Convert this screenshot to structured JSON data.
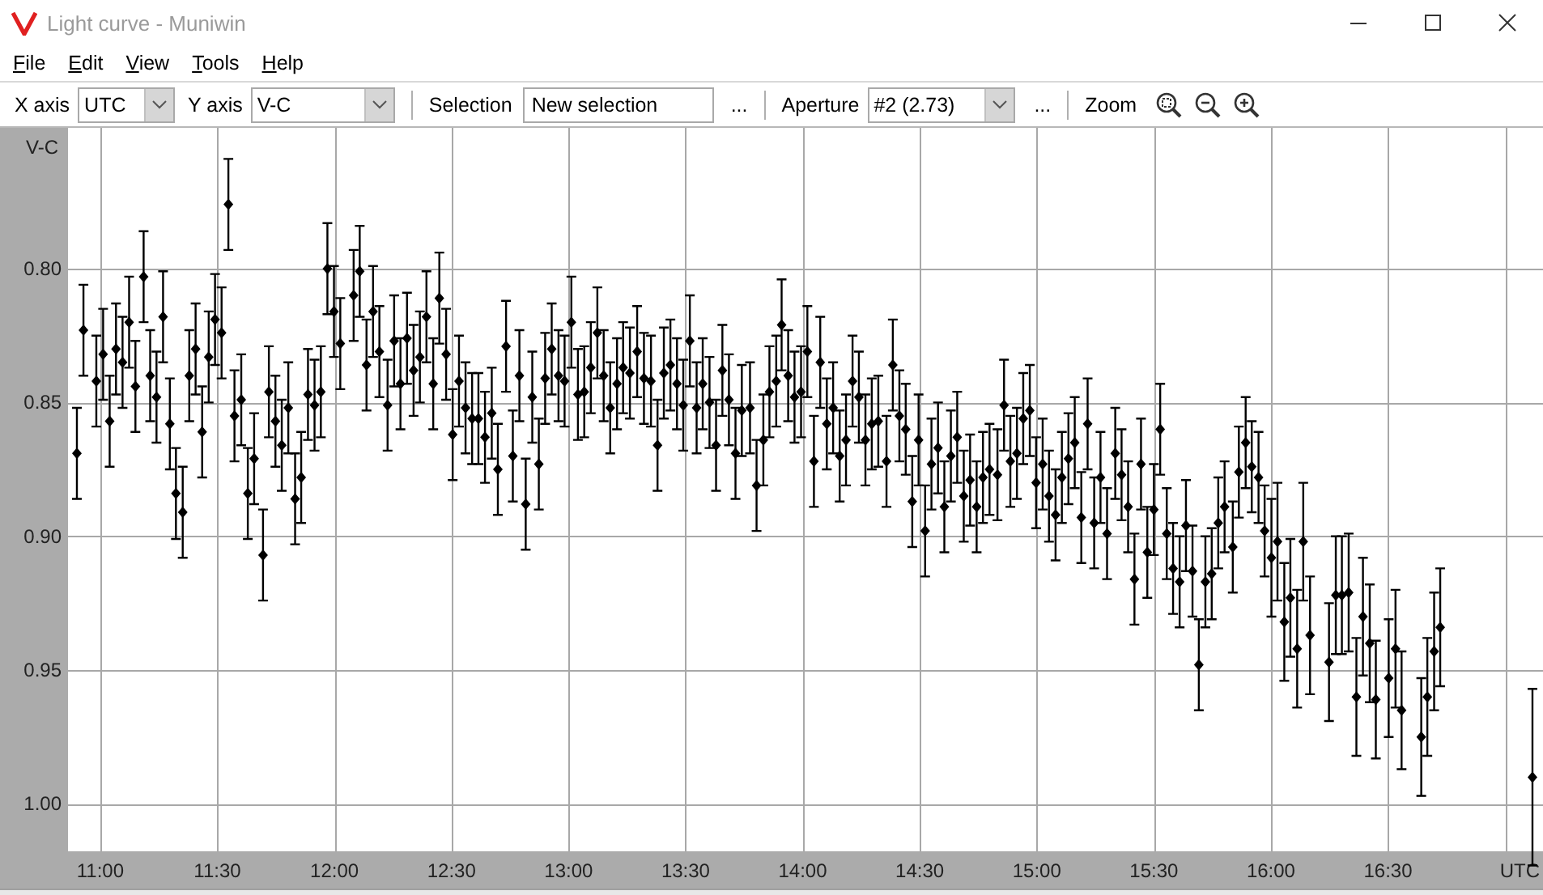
{
  "window": {
    "title": "Light curve - Muniwin"
  },
  "menu": [
    "File",
    "Edit",
    "View",
    "Tools",
    "Help"
  ],
  "toolbar": {
    "x_axis": {
      "label": "X axis",
      "value": "UTC"
    },
    "y_axis": {
      "label": "Y axis",
      "value": "V-C"
    },
    "selection": {
      "label": "Selection",
      "value": "New selection",
      "button": "..."
    },
    "aperture": {
      "label": "Aperture",
      "value": "#2 (2.73)",
      "button": "..."
    },
    "zoom": {
      "label": "Zoom"
    }
  },
  "plot": {
    "chart_data": {
      "type": "scatter",
      "xlabel": "UTC",
      "ylabel": "V-C",
      "grid": true,
      "xlim": [
        10.862,
        17.162
      ],
      "ylim": [
        1.0177,
        0.7486
      ],
      "xticks": [
        {
          "value": 11,
          "label": "11:00"
        },
        {
          "value": 11.5,
          "label": "11:30"
        },
        {
          "value": 12,
          "label": "12:00"
        },
        {
          "value": 12.5,
          "label": "12:30"
        },
        {
          "value": 13,
          "label": "13:00"
        },
        {
          "value": 13.5,
          "label": "13:30"
        },
        {
          "value": 14,
          "label": "14:00"
        },
        {
          "value": 14.5,
          "label": "14:30"
        },
        {
          "value": 15,
          "label": "15:00"
        },
        {
          "value": 15.5,
          "label": "15:30"
        },
        {
          "value": 16,
          "label": "16:00"
        },
        {
          "value": 16.5,
          "label": "16:30"
        }
      ],
      "yticks": [
        {
          "value": 0.8,
          "label": "0.80"
        },
        {
          "value": 0.85,
          "label": "0.85"
        },
        {
          "value": 0.9,
          "label": "0.90"
        },
        {
          "value": 0.95,
          "label": "0.95"
        },
        {
          "value": 1.0,
          "label": "1.00"
        }
      ],
      "x": [
        10.9,
        10.928,
        10.983,
        11.012,
        11.04,
        11.067,
        11.095,
        11.123,
        11.15,
        11.185,
        11.213,
        11.24,
        11.268,
        11.297,
        11.323,
        11.352,
        11.38,
        11.407,
        11.435,
        11.463,
        11.49,
        11.518,
        11.547,
        11.573,
        11.602,
        11.63,
        11.657,
        11.695,
        11.72,
        11.748,
        11.775,
        11.803,
        11.832,
        11.858,
        11.887,
        11.915,
        11.942,
        11.97,
        11.998,
        12.025,
        12.082,
        12.108,
        12.137,
        12.165,
        12.192,
        12.227,
        12.255,
        12.282,
        12.31,
        12.338,
        12.365,
        12.393,
        12.422,
        12.448,
        12.477,
        12.505,
        12.532,
        12.56,
        12.588,
        12.615,
        12.643,
        12.672,
        12.698,
        12.733,
        12.762,
        12.79,
        12.817,
        12.845,
        12.873,
        12.9,
        12.928,
        12.957,
        12.983,
        13.012,
        13.04,
        13.067,
        13.095,
        13.123,
        13.15,
        13.178,
        13.207,
        13.233,
        13.262,
        13.293,
        13.322,
        13.352,
        13.38,
        13.407,
        13.435,
        13.463,
        13.49,
        13.518,
        13.547,
        13.573,
        13.602,
        13.63,
        13.657,
        13.685,
        13.713,
        13.74,
        13.775,
        13.803,
        13.832,
        13.858,
        13.887,
        13.91,
        13.938,
        13.965,
        13.993,
        14.02,
        14.048,
        14.075,
        14.103,
        14.13,
        14.158,
        14.185,
        14.213,
        14.24,
        14.268,
        14.295,
        14.323,
        14.358,
        14.385,
        14.413,
        14.44,
        14.468,
        14.495,
        14.523,
        14.55,
        14.578,
        14.605,
        14.633,
        14.66,
        14.688,
        14.715,
        14.743,
        14.77,
        14.798,
        14.832,
        14.86,
        14.887,
        14.915,
        14.942,
        14.97,
        14.997,
        15.025,
        15.052,
        15.08,
        15.107,
        15.135,
        15.162,
        15.19,
        15.217,
        15.245,
        15.272,
        15.3,
        15.335,
        15.362,
        15.39,
        15.417,
        15.445,
        15.472,
        15.5,
        15.527,
        15.555,
        15.582,
        15.61,
        15.637,
        15.665,
        15.692,
        15.72,
        15.747,
        15.775,
        15.802,
        15.837,
        15.863,
        15.892,
        15.918,
        15.947,
        15.973,
        16.002,
        16.028,
        16.057,
        16.083,
        16.112,
        16.138,
        16.167,
        16.248,
        16.277,
        16.303,
        16.332,
        16.365,
        16.393,
        16.422,
        16.448,
        16.503,
        16.532,
        16.558,
        16.642,
        16.668,
        16.697,
        16.723,
        17.117
      ],
      "series": [
        {
          "color": "#000000",
          "errors": [
            0.017,
            0.017,
            0.017,
            0.017,
            0.017,
            0.017,
            0.017,
            0.017,
            0.017,
            0.017,
            0.017,
            0.017,
            0.017,
            0.017,
            0.017,
            0.017,
            0.017,
            0.017,
            0.017,
            0.017,
            0.017,
            0.017,
            0.017,
            0.017,
            0.017,
            0.017,
            0.017,
            0.017,
            0.017,
            0.017,
            0.017,
            0.017,
            0.017,
            0.017,
            0.017,
            0.017,
            0.017,
            0.017,
            0.017,
            0.017,
            0.017,
            0.017,
            0.017,
            0.017,
            0.017,
            0.017,
            0.017,
            0.017,
            0.017,
            0.017,
            0.017,
            0.017,
            0.017,
            0.017,
            0.017,
            0.017,
            0.017,
            0.017,
            0.017,
            0.017,
            0.017,
            0.017,
            0.017,
            0.017,
            0.017,
            0.017,
            0.017,
            0.017,
            0.017,
            0.017,
            0.017,
            0.017,
            0.017,
            0.017,
            0.017,
            0.017,
            0.017,
            0.017,
            0.017,
            0.017,
            0.017,
            0.017,
            0.017,
            0.017,
            0.017,
            0.017,
            0.017,
            0.017,
            0.017,
            0.017,
            0.017,
            0.017,
            0.017,
            0.017,
            0.017,
            0.017,
            0.017,
            0.017,
            0.017,
            0.017,
            0.017,
            0.017,
            0.017,
            0.017,
            0.017,
            0.017,
            0.017,
            0.017,
            0.017,
            0.017,
            0.017,
            0.017,
            0.017,
            0.017,
            0.017,
            0.017,
            0.017,
            0.017,
            0.017,
            0.017,
            0.017,
            0.017,
            0.017,
            0.017,
            0.017,
            0.017,
            0.017,
            0.017,
            0.017,
            0.017,
            0.017,
            0.017,
            0.017,
            0.017,
            0.017,
            0.017,
            0.017,
            0.017,
            0.017,
            0.017,
            0.017,
            0.017,
            0.017,
            0.017,
            0.017,
            0.017,
            0.017,
            0.017,
            0.017,
            0.017,
            0.017,
            0.017,
            0.017,
            0.017,
            0.017,
            0.017,
            0.017,
            0.017,
            0.017,
            0.017,
            0.017,
            0.017,
            0.017,
            0.017,
            0.017,
            0.017,
            0.017,
            0.017,
            0.017,
            0.017,
            0.017,
            0.017,
            0.017,
            0.017,
            0.017,
            0.017,
            0.017,
            0.017,
            0.017,
            0.017,
            0.022,
            0.022,
            0.022,
            0.022,
            0.022,
            0.022,
            0.022,
            0.022,
            0.022,
            0.022,
            0.022,
            0.022,
            0.022,
            0.022,
            0.022,
            0.022,
            0.022,
            0.022,
            0.022,
            0.022,
            0.022,
            0.022,
            0.033
          ],
          "values": [
            0.869,
            0.823,
            0.842,
            0.832,
            0.857,
            0.83,
            0.835,
            0.82,
            0.844,
            0.803,
            0.84,
            0.848,
            0.818,
            0.858,
            0.884,
            0.891,
            0.84,
            0.83,
            0.861,
            0.833,
            0.819,
            0.824,
            0.776,
            0.855,
            0.849,
            0.884,
            0.871,
            0.907,
            0.846,
            0.857,
            0.866,
            0.852,
            0.886,
            0.878,
            0.847,
            0.851,
            0.846,
            0.8,
            0.816,
            0.828,
            0.81,
            0.801,
            0.836,
            0.816,
            0.831,
            0.851,
            0.827,
            0.843,
            0.826,
            0.838,
            0.833,
            0.818,
            0.843,
            0.811,
            0.832,
            0.862,
            0.842,
            0.852,
            0.856,
            0.856,
            0.863,
            0.854,
            0.875,
            0.829,
            0.87,
            0.84,
            0.888,
            0.848,
            0.873,
            0.841,
            0.83,
            0.84,
            0.842,
            0.82,
            0.847,
            0.846,
            0.837,
            0.824,
            0.84,
            0.852,
            0.843,
            0.837,
            0.839,
            0.831,
            0.841,
            0.842,
            0.866,
            0.839,
            0.836,
            0.843,
            0.851,
            0.827,
            0.852,
            0.843,
            0.85,
            0.866,
            0.838,
            0.849,
            0.869,
            0.853,
            0.852,
            0.881,
            0.864,
            0.846,
            0.842,
            0.821,
            0.84,
            0.848,
            0.846,
            0.831,
            0.872,
            0.835,
            0.858,
            0.852,
            0.87,
            0.864,
            0.842,
            0.848,
            0.864,
            0.858,
            0.857,
            0.872,
            0.836,
            0.855,
            0.86,
            0.887,
            0.864,
            0.898,
            0.873,
            0.867,
            0.889,
            0.87,
            0.863,
            0.885,
            0.879,
            0.889,
            0.878,
            0.875,
            0.877,
            0.851,
            0.872,
            0.869,
            0.856,
            0.853,
            0.88,
            0.873,
            0.885,
            0.892,
            0.878,
            0.871,
            0.865,
            0.893,
            0.858,
            0.895,
            0.878,
            0.899,
            0.869,
            0.877,
            0.889,
            0.916,
            0.873,
            0.906,
            0.89,
            0.86,
            0.899,
            0.912,
            0.917,
            0.896,
            0.913,
            0.948,
            0.917,
            0.914,
            0.895,
            0.889,
            0.904,
            0.876,
            0.865,
            0.874,
            0.878,
            0.898,
            0.908,
            0.902,
            0.932,
            0.923,
            0.942,
            0.902,
            0.937,
            0.947,
            0.922,
            0.922,
            0.921,
            0.96,
            0.93,
            0.94,
            0.961,
            0.953,
            0.942,
            0.965,
            0.975,
            0.96,
            0.943,
            0.934,
            0.99
          ]
        }
      ]
    }
  }
}
